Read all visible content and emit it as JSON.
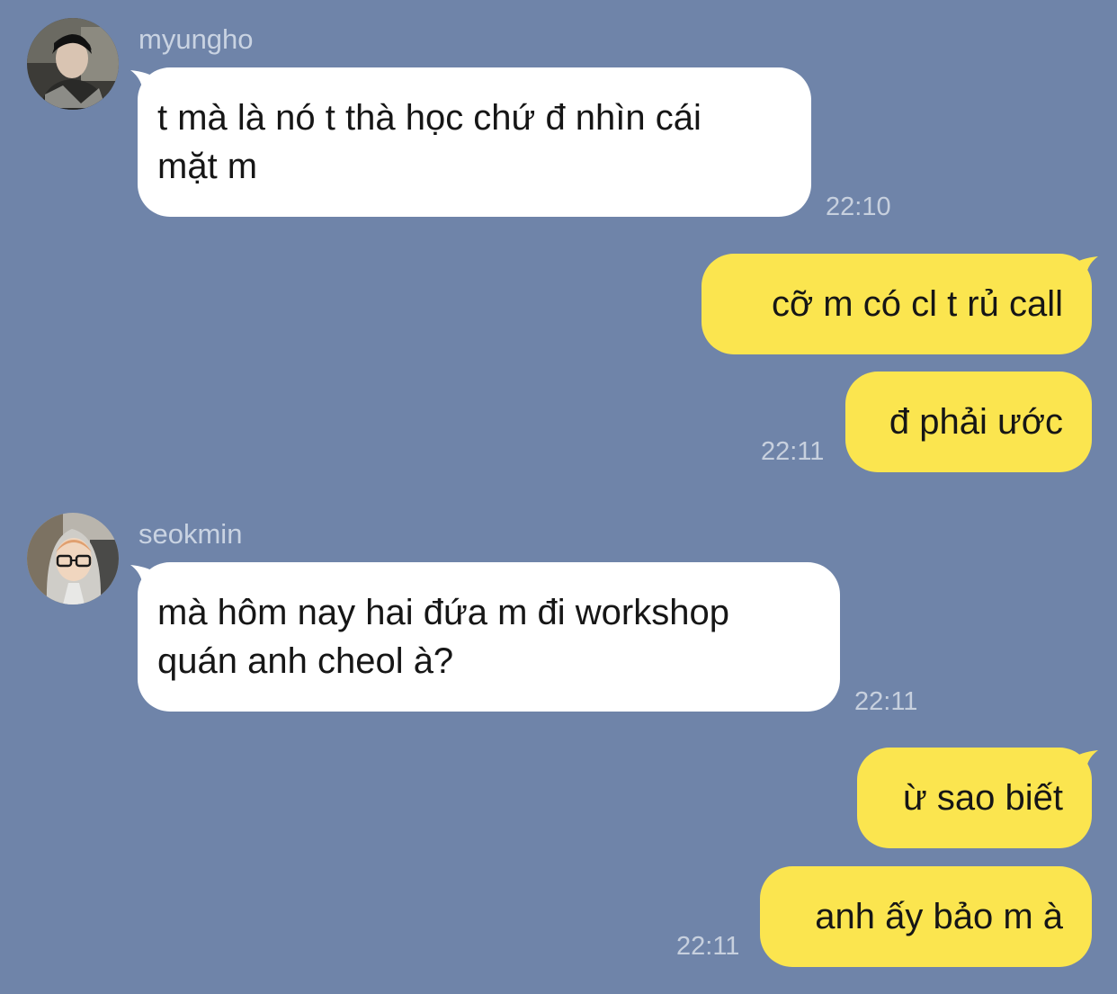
{
  "colors": {
    "background": "#6f84a9",
    "incoming_bubble": "#ffffff",
    "outgoing_bubble": "#fbe54f",
    "meta_text": "#c7d0de"
  },
  "messages": [
    {
      "sender": "myungho",
      "avatar_icon": "profile-photo-avatar",
      "lines": [
        "t mà là nó t thà học chứ đ nhìn cái",
        "mặt m"
      ],
      "time": "22:10"
    },
    {
      "outgoing_1": "cỡ m có cl t rủ call",
      "outgoing_2": "đ phải ước",
      "time": "22:11"
    },
    {
      "sender": "seokmin",
      "avatar_icon": "profile-photo-avatar",
      "lines": [
        "mà hôm nay hai đứa m đi workshop",
        "quán anh cheol à?"
      ],
      "time": "22:11"
    },
    {
      "outgoing_1": "ừ sao biết",
      "outgoing_2": "anh ấy bảo m à",
      "time": "22:11"
    }
  ]
}
